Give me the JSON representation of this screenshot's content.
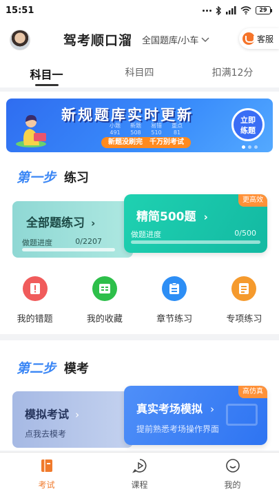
{
  "status_bar": {
    "time": "15:51",
    "battery": "29"
  },
  "header": {
    "app_title": "驾考顺口溜",
    "bank_selector": "全国题库/小车",
    "service_label": "客服"
  },
  "tabs": [
    {
      "label": "科目一",
      "active": true
    },
    {
      "label": "科目四",
      "active": false
    },
    {
      "label": "扣满12分",
      "active": false
    }
  ],
  "banner": {
    "title": "新规题库实时更新",
    "tagline": "新题没刷完　千万别考试",
    "cta": [
      "立即",
      "练题"
    ],
    "screen_stats": [
      {
        "label": "小题",
        "value": "491"
      },
      {
        "label": "新题",
        "value": "508"
      },
      {
        "label": "易错",
        "value": "510"
      },
      {
        "label": "重点",
        "value": "81"
      }
    ]
  },
  "step1": {
    "step": "第一步",
    "name": "练习",
    "card_all": {
      "title": "全部题练习",
      "progress_label": "做题进度",
      "progress_value": "0/2207",
      "progress_fraction": 0
    },
    "card_500": {
      "title": "精简500题",
      "badge": "更高效",
      "progress_label": "做题进度",
      "progress_value": "0/500",
      "progress_fraction": 0
    },
    "shortcuts": [
      {
        "label": "我的错题",
        "color": "#f05b5b",
        "icon": "exclamation-doc-icon"
      },
      {
        "label": "我的收藏",
        "color": "#2dbf4a",
        "icon": "list-doc-icon"
      },
      {
        "label": "章节练习",
        "color": "#2d8ef5",
        "icon": "clipboard-icon"
      },
      {
        "label": "专项练习",
        "color": "#f59a2d",
        "icon": "clipboard-list-icon"
      }
    ]
  },
  "step2": {
    "step": "第二步",
    "name": "模考",
    "card_mock": {
      "title": "模拟考试",
      "subtitle": "点我去模考"
    },
    "card_real": {
      "title": "真实考场模拟",
      "subtitle": "提前熟悉考场操作界面",
      "badge": "高仿真"
    }
  },
  "bottom_nav": [
    {
      "label": "考试",
      "active": true,
      "icon": "book-icon"
    },
    {
      "label": "课程",
      "active": false,
      "icon": "play-bubble-icon"
    },
    {
      "label": "我的",
      "active": false,
      "icon": "smile-icon"
    }
  ],
  "colors": {
    "accent": "#f07a2c",
    "step_blue": "#3a86f5",
    "teal": "#1fd1b1"
  }
}
